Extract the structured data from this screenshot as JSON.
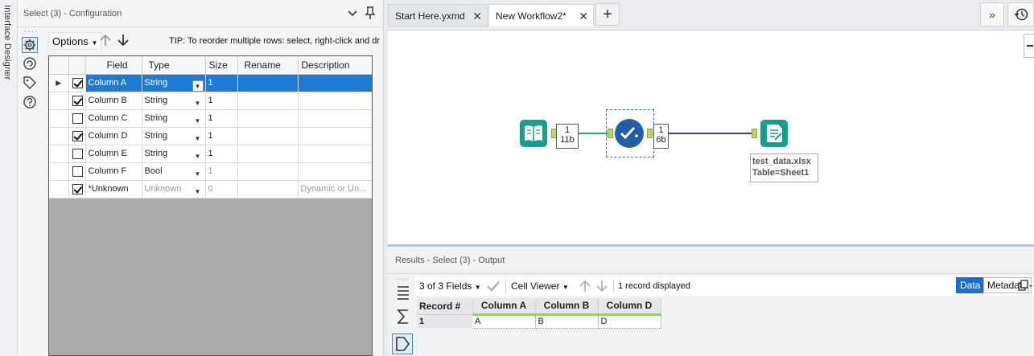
{
  "rail": {
    "label": "Interface Designer"
  },
  "config": {
    "title": "Select (3) - Configuration",
    "options_label": "Options",
    "tip": "TIP: To reorder multiple rows: select, right-click and dr",
    "columns": [
      "Field",
      "Type",
      "Size",
      "Rename",
      "Description"
    ],
    "rows": [
      {
        "checked": true,
        "field": "Column A",
        "type": "String",
        "size": "1",
        "rename": "",
        "description": "",
        "selected": true
      },
      {
        "checked": true,
        "field": "Column B",
        "type": "String",
        "size": "1",
        "rename": "",
        "description": ""
      },
      {
        "checked": false,
        "field": "Column C",
        "type": "String",
        "size": "1",
        "rename": "",
        "description": ""
      },
      {
        "checked": true,
        "field": "Column D",
        "type": "String",
        "size": "1",
        "rename": "",
        "description": ""
      },
      {
        "checked": false,
        "field": "Column E",
        "type": "String",
        "size": "1",
        "rename": "",
        "description": ""
      },
      {
        "checked": false,
        "field": "Column F",
        "type": "Bool",
        "size": "1",
        "rename": "",
        "description": ""
      },
      {
        "checked": true,
        "field": "*Unknown",
        "type": "Unknown",
        "size": "0",
        "rename": "",
        "description": "Dynamic or Un..."
      }
    ]
  },
  "tabs": [
    {
      "label": "Start Here.yxmd"
    },
    {
      "label": "New Workflow2*"
    }
  ],
  "canvas": {
    "input_count": {
      "records": "1",
      "size": "11b"
    },
    "select_count": {
      "records": "1",
      "size": "6b"
    },
    "output_annotation": {
      "line1": "test_data.xlsx",
      "line2": "Table=Sheet1"
    },
    "colors": {
      "input_tool": "#1a9e8c",
      "select_tool": "#1f5fa6",
      "output_tool": "#1a9e8c",
      "link1": "#3aa36d",
      "link2": "#3b3f99"
    }
  },
  "results": {
    "title": "Results - Select (3) - Output",
    "fields_label": "3 of 3 Fields",
    "cell_viewer_label": "Cell Viewer",
    "records_label": "1 record displayed",
    "data_label": "Data",
    "metadata_label": "Metadata",
    "columns": [
      "Record #",
      "Column A",
      "Column B",
      "Column D"
    ],
    "rows": [
      {
        "record": "1",
        "values": [
          "A",
          "B",
          "D"
        ]
      }
    ]
  }
}
